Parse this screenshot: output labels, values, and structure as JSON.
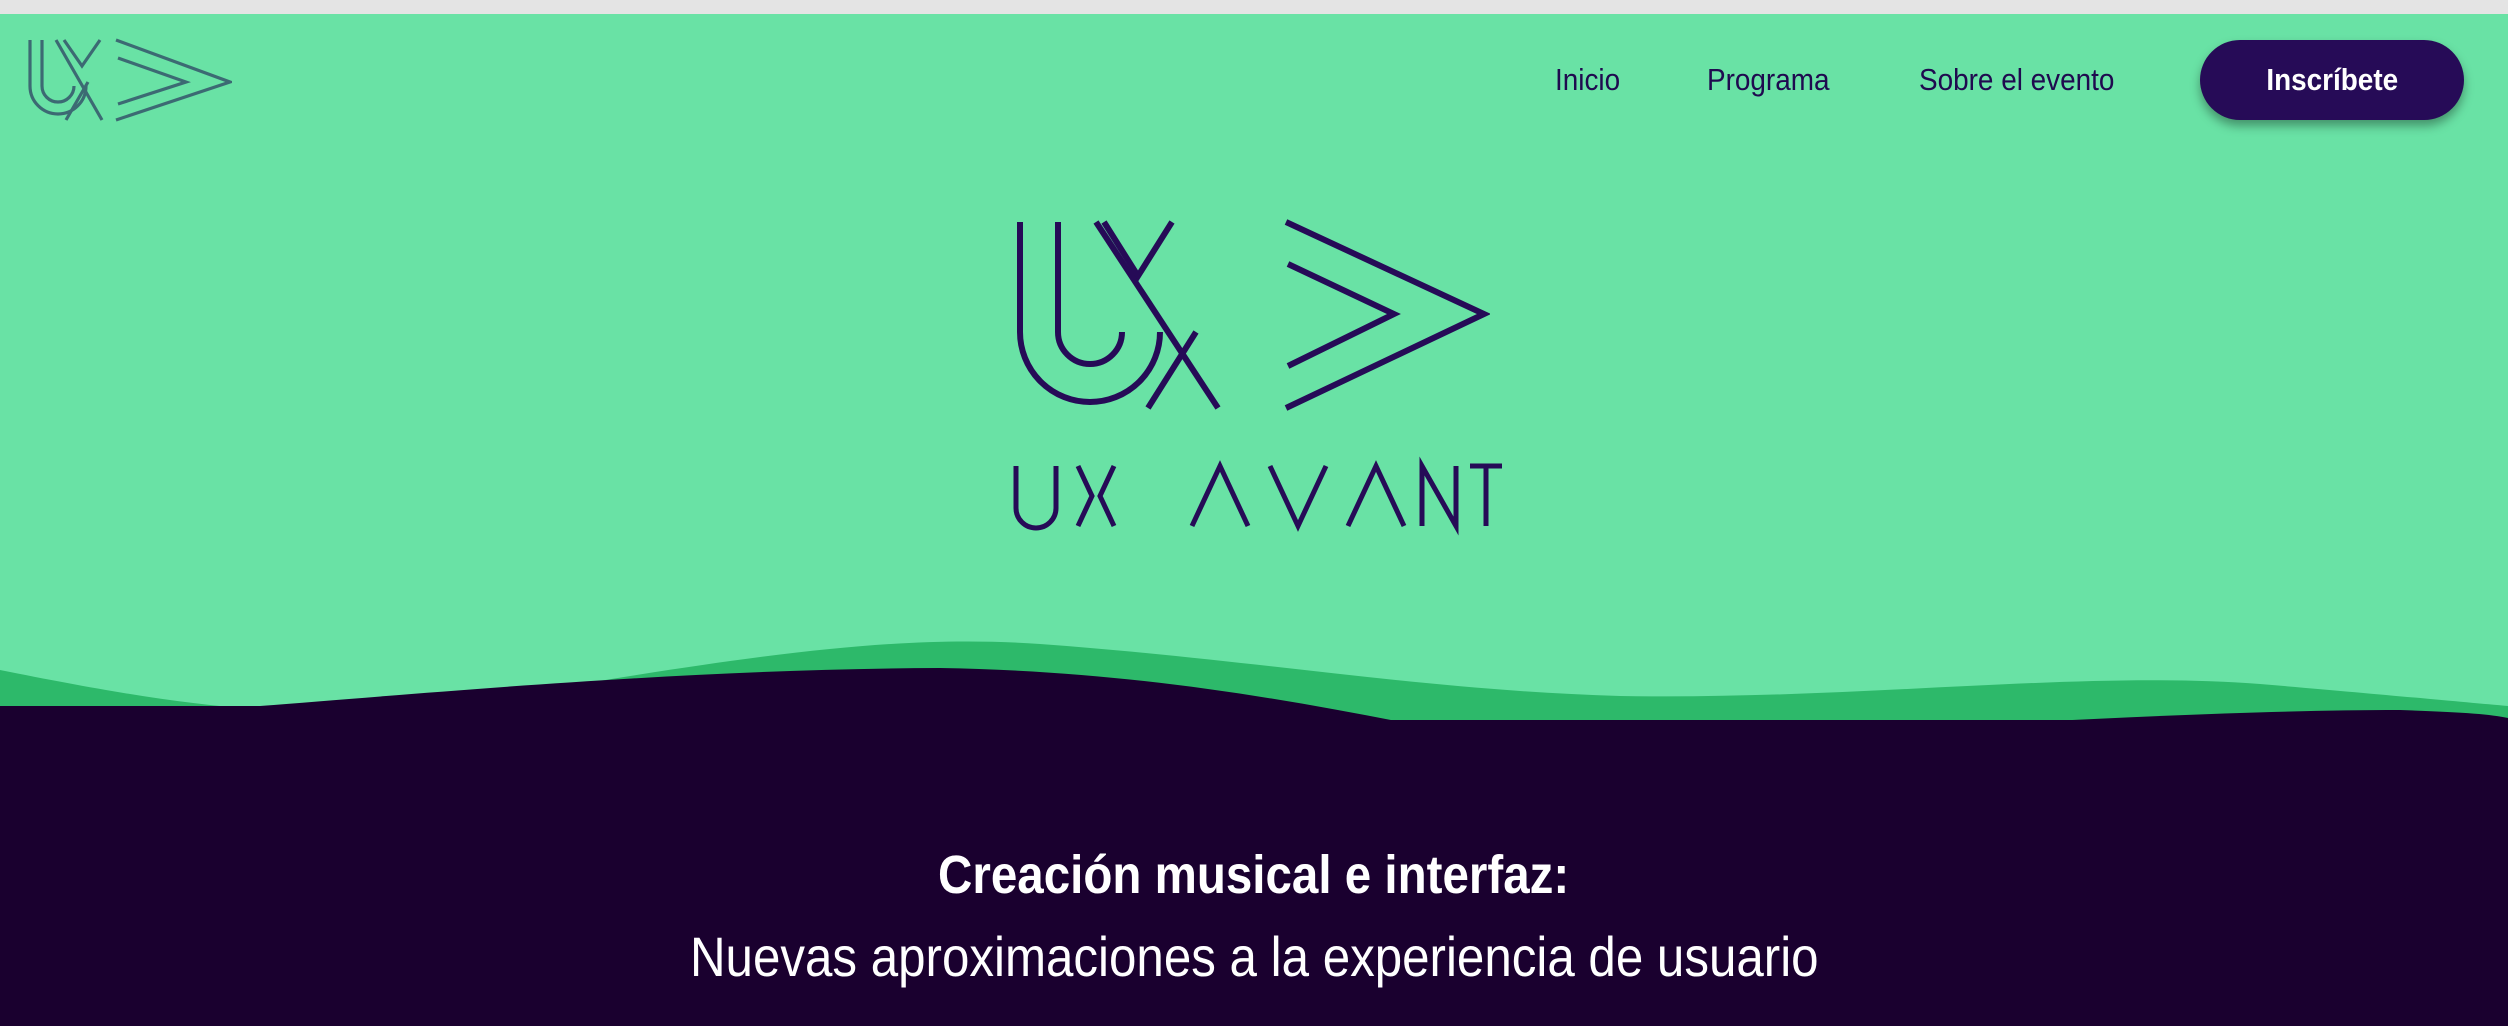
{
  "header": {
    "logo": "ux-avant-logo-icon",
    "nav": [
      {
        "label": "Inicio"
      },
      {
        "label": "Programa"
      },
      {
        "label": "Sobre el evento"
      }
    ],
    "cta_label": "Inscríbete"
  },
  "hero": {
    "logo": "ux-avant-logo-icon",
    "wordmark": "UX AVANT"
  },
  "band": {
    "title": "Creación musical e interfaz:",
    "subtitle": "Nuevas aproximaciones a la experiencia de usuario"
  },
  "colors": {
    "mint": "#69e2a5",
    "green": "#2db96a",
    "deep_purple": "#1a002f",
    "brand_purple": "#260b57",
    "nav_text": "#1f0a4f",
    "logo_small": "#3c6a73"
  }
}
